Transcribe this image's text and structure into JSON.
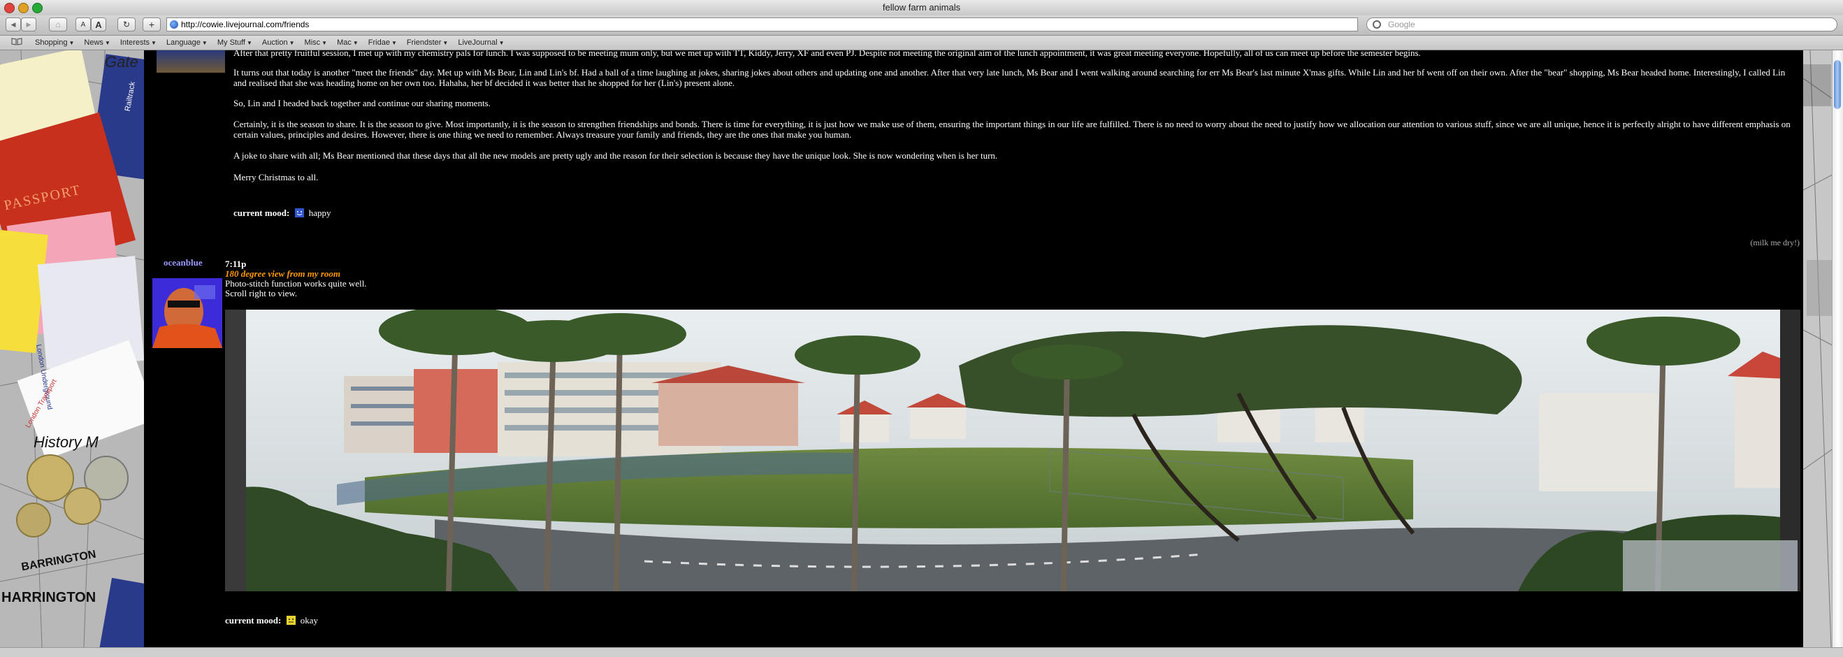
{
  "window": {
    "title": "fellow farm animals"
  },
  "toolbar": {
    "back_label": "◀",
    "forward_label": "▶",
    "home_label": "⌂",
    "smaller_text_label": "A",
    "larger_text_label": "A",
    "reload_label": "↻",
    "add_bookmark_label": "+",
    "url": "http://cowie.livejournal.com/friends",
    "search_placeholder": "Google"
  },
  "bookmarks": [
    {
      "label": "Shopping"
    },
    {
      "label": "News"
    },
    {
      "label": "Interests"
    },
    {
      "label": "Language"
    },
    {
      "label": "My Stuff"
    },
    {
      "label": "Auction"
    },
    {
      "label": "Misc"
    },
    {
      "label": "Mac"
    },
    {
      "label": "Fridae"
    },
    {
      "label": "Friendster"
    },
    {
      "label": "LiveJournal"
    }
  ],
  "entry1": {
    "para_cut": "After that pretty fruitful session, I met up with my chemistry pals for lunch. I was supposed to be meeting mum only, but we met up with TT, Kiddy, Jerry, XF and even PJ. Despite not meeting the original aim of the lunch appointment, it was great meeting everyone. Hopefully, all of us can meet up before the semester begins.",
    "para1": "It turns out that today is another \"meet the friends\" day. Met up with Ms Bear, Lin and Lin's bf. Had a ball of a time laughing at jokes, sharing jokes about others and updating one and another. After that very late lunch, Ms Bear and I went walking around searching for err Ms Bear's last minute X'mas gifts. While Lin and her bf went off on their own. After the \"bear\" shopping, Ms Bear headed home. Interestingly, I called Lin and realised that she was heading home on her own too. Hahaha, her bf decided it was better that he shopped for her (Lin's) present alone.",
    "para2": "So, Lin and I headed back together and continue our sharing moments.",
    "para3": "Certainly, it is the season to share. It is the season to give. Most importantly, it is the season to strengthen friendships and bonds. There is time for everything, it is just how we make use of them, ensuring the important things in our life are fulfilled. There is no need to worry about the need to justify how we allocation our attention to various stuff, since we are all unique, hence it is perfectly alright to have different emphasis on certain values, principles and desires. However, there is one thing we need to remember. Always treasure your family and friends, they are the ones that make you human.",
    "para4": "A joke to share with all; Ms Bear mentioned that these days that all the new models are pretty ugly and the reason for their selection is because they have the unique look. She is now wondering when is her turn.",
    "para5": "Merry Christmas to all.",
    "mood_label": "current mood:",
    "mood_value": "happy",
    "comment_link": "(milk me dry!)"
  },
  "entry2": {
    "username": "oceanblue",
    "time": "7:11p",
    "subject": "180 degree view from my room",
    "line1": "Photo-stitch function works quite well.",
    "line2": "Scroll right to view.",
    "mood_label": "current mood:",
    "mood_value": "okay"
  },
  "collage": {
    "ticket1": "Railtrack",
    "passport": "PASSPORT",
    "underground": "London Underground",
    "transport": "London Transport",
    "history": "History M",
    "harrington": "HARRINGTON",
    "street1": "BARRINGTON",
    "gate": "Gate"
  },
  "colors": {
    "background": "#000000",
    "subject": "#ff9900",
    "username": "#9999ff",
    "mood_icon_happy": "#3355cc",
    "mood_icon_okay": "#e8d230"
  }
}
